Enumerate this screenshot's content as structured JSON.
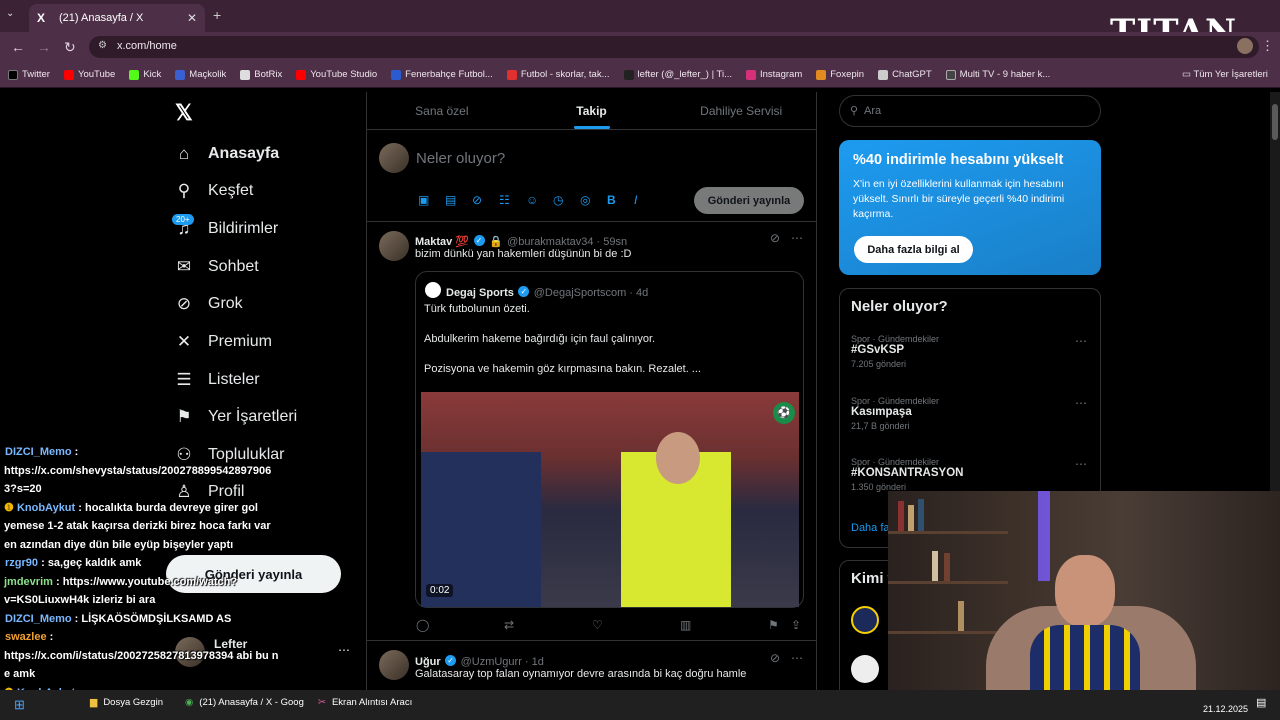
{
  "browser": {
    "tab_title": "(21) Anasayfa / X",
    "tab_close": "✕",
    "new_tab": "+",
    "url": "x.com/home",
    "bookmarks": [
      "Twitter",
      "YouTube",
      "Kick",
      "Maçkolik",
      "BotRix",
      "YouTube Studio",
      "Fenerbahçe Futbol...",
      "Futbol - skorlar, tak...",
      "lefter (@_lefter_) | Ti...",
      "Instagram",
      "Foxepin",
      "ChatGPT",
      "Multi TV - 9 haber k..."
    ],
    "all_bookmarks": "Tüm Yer İşaretleri",
    "overlay_logo": "TITAN"
  },
  "sidebar": {
    "badge": "20+",
    "items": [
      {
        "label": "Anasayfa",
        "icon": "home-icon"
      },
      {
        "label": "Keşfet",
        "icon": "search-icon"
      },
      {
        "label": "Bildirimler",
        "icon": "bell-icon"
      },
      {
        "label": "Sohbet",
        "icon": "mail-icon"
      },
      {
        "label": "Grok",
        "icon": "grok-icon"
      },
      {
        "label": "Premium",
        "icon": "x-icon"
      },
      {
        "label": "Listeler",
        "icon": "list-icon"
      },
      {
        "label": "Yer İşaretleri",
        "icon": "bookmark-icon"
      },
      {
        "label": "Topluluklar",
        "icon": "community-icon"
      },
      {
        "label": "Profil",
        "icon": "profile-icon"
      }
    ],
    "post_button": "Gönderi yayınla",
    "account_name": "Lefter"
  },
  "feed": {
    "tabs": [
      "Sana özel",
      "Takip",
      "Dahiliye Servisi"
    ],
    "compose_placeholder": "Neler oluyor?",
    "publish": "Gönderi yayınla",
    "tweets": [
      {
        "name": "Maktav 💯",
        "handle": "@burakmaktav34 · 59sn",
        "text": "bizim dünkü yan hakemleri düşünün bi de :D",
        "quote": {
          "name": "Degaj Sports",
          "handle": "@DegajSportscom · 4d",
          "line1": "Türk futbolunun özeti.",
          "line2": "Abdulkerim hakeme bağırdığı için faul çalınıyor.",
          "line3": "Pozisyona ve hakemin göz kırpmasına bakın. Rezalet. ...",
          "video_time": "0:02"
        }
      },
      {
        "name": "Uğur",
        "handle": "@UzmUgurr · 1d",
        "text": "Galatasaray top falan oynamıyor devre arasında bi kaç doğru hamle"
      }
    ]
  },
  "right": {
    "search_placeholder": "Ara",
    "premium_title": "%40 indirimle hesabını yükselt",
    "premium_text": "X'in en iyi özelliklerini kullanmak için hesabını yükselt. Sınırlı bir süreyle geçerli %40 indirimi kaçırma.",
    "premium_button": "Daha fazla bilgi al",
    "trends_title": "Neler oluyor?",
    "trends": [
      {
        "category": "Spor · Gündemdekiler",
        "name": "#GSvKSP",
        "count": "7.205 gönderi"
      },
      {
        "category": "Spor · Gündemdekiler",
        "name": "Kasımpaşa",
        "count": "21,7 B gönderi"
      },
      {
        "category": "Spor · Gündemdekiler",
        "name": "#KONSANTRASYON",
        "count": "1.350 gönderi"
      }
    ],
    "show_more": "Daha fa",
    "who_to_follow": "Kimi t"
  },
  "chat": [
    {
      "user": "DIZCI_Memo",
      "msg": "https://x.com/shevysta/status/2002788995428979063?s=20"
    },
    {
      "user": "KnobAykut",
      "msg": "hocalıkta burda devreye girer gol yemese 1-2 atak kaçırsa derizki birez hoca farkı var en azından diye dün bile eyüp bişeyler yaptı"
    },
    {
      "user": "rzgr90",
      "msg": "sa,geç kaldık amk"
    },
    {
      "user": "jmdevrim",
      "msg": "https://www.youtube.com/watch?v=KS0LiuxwH4k izleriz bi ara"
    },
    {
      "user": "DIZCI_Memo",
      "msg": "LİŞKAÖSÖMDŞİLKSAMD AS"
    },
    {
      "user": "swazlee",
      "msg": "https://x.com/i/status/2002725827813978394 abi bu ne amk"
    },
    {
      "user": "KnobAykut",
      "msg": ""
    }
  ],
  "taskbar": {
    "items": [
      "Dosya Gezgin",
      "(21) Anasayfa / X - Goog",
      "Ekran Alıntısı Aracı"
    ],
    "date": "21.12.2025"
  }
}
